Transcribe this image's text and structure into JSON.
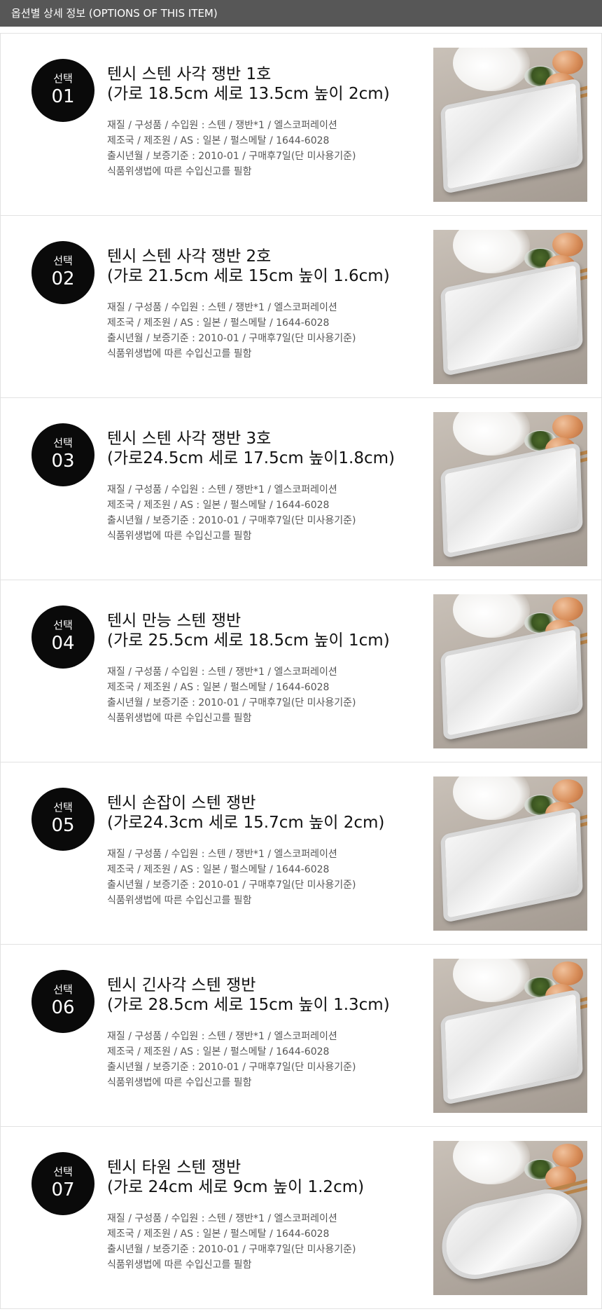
{
  "header": {
    "title": "옵션별 상세 정보 (OPTIONS OF THIS ITEM)"
  },
  "badge_label": "선택",
  "items": [
    {
      "num": "01",
      "title_line1": "텐시 스텐 사각 쟁반 1호",
      "title_line2": "(가로 18.5cm 세로 13.5cm 높이 2cm)",
      "spec1": "재질 / 구성품 / 수입원 : 스텐 / 쟁반*1 / 엘스코퍼레이션",
      "spec2": "제조국 / 제조원 / AS : 일본 / 펄스메탈 / 1644-6028",
      "spec3": "출시년월 / 보증기준 : 2010-01 / 구매후7일(단 미사용기준)",
      "spec4": "식품위생법에 따른 수입신고를 필함"
    },
    {
      "num": "02",
      "title_line1": "텐시 스텐 사각 쟁반 2호",
      "title_line2": "(가로 21.5cm 세로 15cm 높이 1.6cm)",
      "spec1": "재질 / 구성품 / 수입원 : 스텐 / 쟁반*1 / 엘스코퍼레이션",
      "spec2": "제조국 / 제조원 / AS : 일본 / 펄스메탈 / 1644-6028",
      "spec3": "출시년월 / 보증기준 : 2010-01 / 구매후7일(단 미사용기준)",
      "spec4": "식품위생법에 따른 수입신고를 필함"
    },
    {
      "num": "03",
      "title_line1": "텐시 스텐 사각 쟁반 3호",
      "title_line2": "(가로24.5cm 세로 17.5cm 높이1.8cm)",
      "spec1": "재질 / 구성품 / 수입원 : 스텐 / 쟁반*1 / 엘스코퍼레이션",
      "spec2": "제조국 / 제조원 / AS : 일본 / 펄스메탈 / 1644-6028",
      "spec3": "출시년월 / 보증기준 : 2010-01 / 구매후7일(단 미사용기준)",
      "spec4": "식품위생법에 따른 수입신고를 필함"
    },
    {
      "num": "04",
      "title_line1": "텐시 만능 스텐 쟁반",
      "title_line2": "(가로 25.5cm 세로 18.5cm 높이 1cm)",
      "spec1": "재질 / 구성품 / 수입원 : 스텐 / 쟁반*1 / 엘스코퍼레이션",
      "spec2": "제조국 / 제조원 / AS : 일본 / 펄스메탈 / 1644-6028",
      "spec3": "출시년월 / 보증기준 : 2010-01 / 구매후7일(단 미사용기준)",
      "spec4": "식품위생법에 따른 수입신고를 필함"
    },
    {
      "num": "05",
      "title_line1": "텐시 손잡이 스텐 쟁반",
      "title_line2": "(가로24.3cm 세로 15.7cm 높이 2cm)",
      "spec1": "재질 / 구성품 / 수입원 : 스텐 / 쟁반*1 / 엘스코퍼레이션",
      "spec2": "제조국 / 제조원 / AS : 일본 / 펄스메탈 / 1644-6028",
      "spec3": "출시년월 / 보증기준 : 2010-01 / 구매후7일(단 미사용기준)",
      "spec4": "식품위생법에 따른 수입신고를 필함"
    },
    {
      "num": "06",
      "title_line1": "텐시 긴사각 스텐 쟁반",
      "title_line2": "(가로 28.5cm 세로 15cm 높이 1.3cm)",
      "spec1": "재질 / 구성품 / 수입원 : 스텐 / 쟁반*1 / 엘스코퍼레이션",
      "spec2": "제조국 / 제조원 / AS : 일본 / 펄스메탈 / 1644-6028",
      "spec3": "출시년월 / 보증기준 : 2010-01 / 구매후7일(단 미사용기준)",
      "spec4": "식품위생법에 따른 수입신고를 필함"
    },
    {
      "num": "07",
      "title_line1": "텐시 타원 스텐 쟁반",
      "title_line2": "(가로 24cm 세로 9cm 높이 1.2cm)",
      "spec1": "재질 / 구성품 / 수입원 : 스텐 / 쟁반*1 / 엘스코퍼레이션",
      "spec2": "제조국 / 제조원 / AS : 일본 / 펄스메탈 / 1644-6028",
      "spec3": "출시년월 / 보증기준 : 2010-01 / 구매후7일(단 미사용기준)",
      "spec4": "식품위생법에 따른 수입신고를 필함"
    }
  ]
}
